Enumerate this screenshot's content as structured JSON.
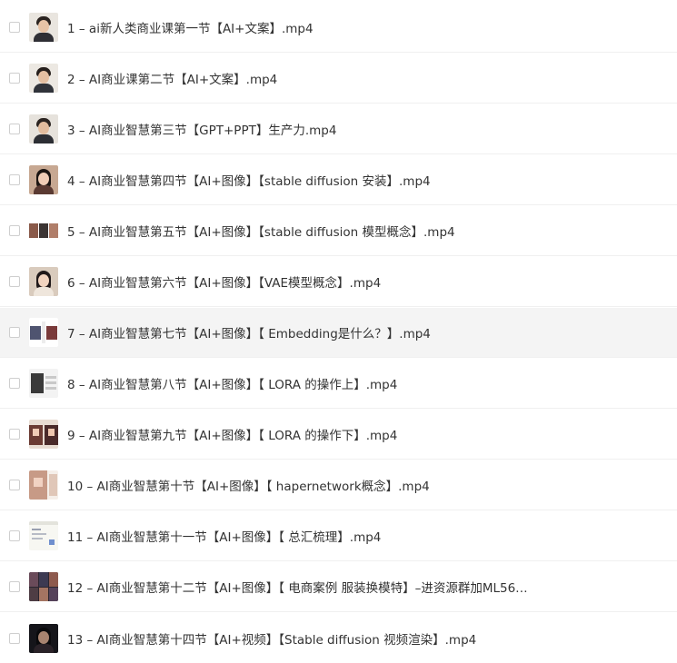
{
  "files": [
    {
      "name": "1 – ai新人类商业课第一节【AI+文案】.mp4",
      "thumb": "man-portrait-icon"
    },
    {
      "name": "2 – AI商业课第二节【AI+文案】.mp4",
      "thumb": "man-portrait-icon"
    },
    {
      "name": "3 – AI商业智慧第三节【GPT+PPT】生产力.mp4",
      "thumb": "man-portrait-icon"
    },
    {
      "name": "4 – AI商业智慧第四节【AI+图像】【stable diffusion 安装】.mp4",
      "thumb": "woman-portrait-icon"
    },
    {
      "name": "5 – AI商业智慧第五节【AI+图像】【stable diffusion 模型概念】.mp4",
      "thumb": "image-grid-icon"
    },
    {
      "name": "6 – AI商业智慧第六节【AI+图像】【VAE模型概念】.mp4",
      "thumb": "woman-portrait-icon"
    },
    {
      "name": "7 – AI商业智慧第七节【AI+图像】【 Embedding是什么？】.mp4",
      "thumb": "image-grid-icon"
    },
    {
      "name": "8 – AI商业智慧第八节【AI+图像】【 LORA 的操作上】.mp4",
      "thumb": "image-grid-icon"
    },
    {
      "name": "9 – AI商业智慧第九节【AI+图像】【 LORA 的操作下】.mp4",
      "thumb": "woman-portrait-icon"
    },
    {
      "name": "10 – AI商业智慧第十节【AI+图像】【 hapernetwork概念】.mp4",
      "thumb": "woman-portrait-icon"
    },
    {
      "name": "11 – AI商业智慧第十一节【AI+图像】【 总汇梳理】.mp4",
      "thumb": "screenshot-icon"
    },
    {
      "name": "12 – AI商业智慧第十二节【AI+图像】【 电商案例 服装换模特】–进资源群加ML56…",
      "thumb": "image-grid-icon"
    },
    {
      "name": "13 – AI商业智慧第十四节【AI+视频】【Stable diffusion 视频渲染】.mp4",
      "thumb": "dark-portrait-icon"
    }
  ],
  "colors": {
    "text": "#333333",
    "hover_row": "#f4f4f4",
    "divider": "#f0f0f0",
    "checkbox_border": "#cfcfcf"
  }
}
